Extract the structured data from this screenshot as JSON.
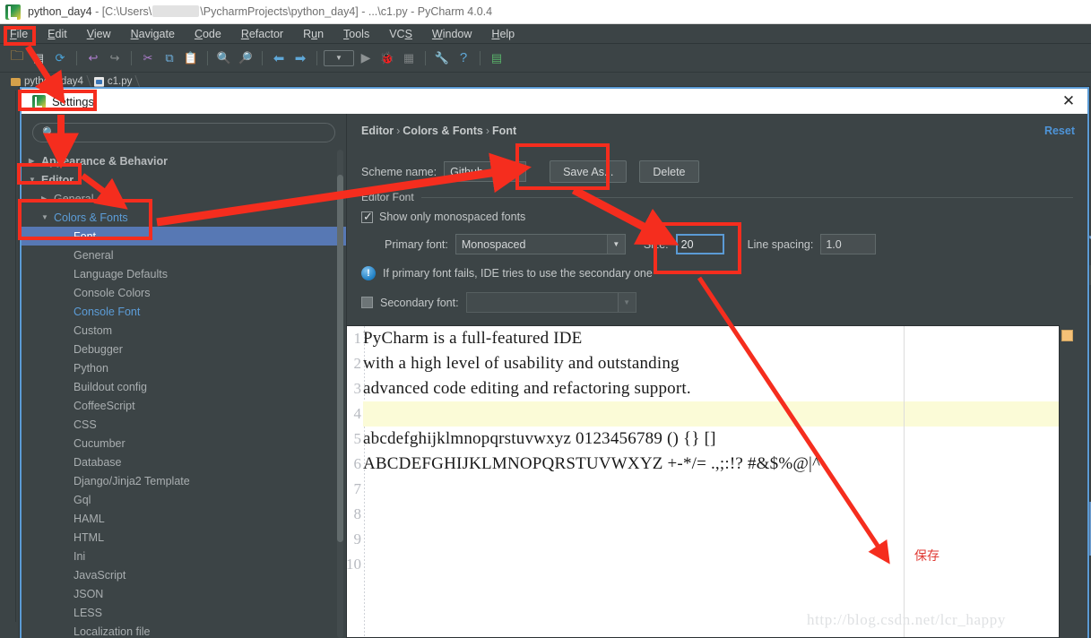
{
  "ide": {
    "window_title_app": "python_day4",
    "window_title_rest_1": " - [C:\\Users\\",
    "window_title_rest_2": "\\PycharmProjects\\python_day4] - ...\\c1.py - PyCharm 4.0.4",
    "logo_icon": "pycharm-logo-icon",
    "menu": [
      {
        "label": "File",
        "mnemonic": "F"
      },
      {
        "label": "Edit",
        "mnemonic": "E"
      },
      {
        "label": "View",
        "mnemonic": "V"
      },
      {
        "label": "Navigate",
        "mnemonic": "N"
      },
      {
        "label": "Code",
        "mnemonic": "C"
      },
      {
        "label": "Refactor",
        "mnemonic": "R"
      },
      {
        "label": "Run",
        "mnemonic": "R"
      },
      {
        "label": "Tools",
        "mnemonic": "T"
      },
      {
        "label": "VCS",
        "mnemonic": "S"
      },
      {
        "label": "Window",
        "mnemonic": "W"
      },
      {
        "label": "Help",
        "mnemonic": "H"
      }
    ],
    "toolbar_icons": [
      "open-folder-icon",
      "save-all-icon",
      "sync-icon",
      "undo-icon",
      "redo-icon",
      "cut-icon",
      "copy-icon",
      "paste-icon",
      "find-icon",
      "find-usages-icon",
      "back-icon",
      "forward-icon",
      "run-configurations-icon",
      "run-icon",
      "debug-icon",
      "coverage-icon",
      "settings-wrench-icon",
      "help-icon",
      "deploy-icon"
    ],
    "tabs": [
      {
        "label": "python_day4",
        "icon": "folder-icon"
      },
      {
        "label": "c1.py",
        "icon": "python-file-icon"
      }
    ]
  },
  "dialog": {
    "title": "Settings",
    "logo_icon": "pycharm-logo-icon",
    "close_icon": "close-icon",
    "search": {
      "placeholder": "",
      "value": "",
      "icon": "search-icon"
    },
    "tree": [
      {
        "label": "Appearance & Behavior",
        "level": 0,
        "twisty": "right",
        "style": "bold"
      },
      {
        "label": "Editor",
        "level": 0,
        "twisty": "down",
        "style": "bold"
      },
      {
        "label": "General",
        "level": 1,
        "twisty": "right",
        "style": "normal"
      },
      {
        "label": "Colors & Fonts",
        "level": 1,
        "twisty": "down",
        "style": "accent"
      },
      {
        "label": "Font",
        "level": 2,
        "twisty": "none",
        "style": "selected"
      },
      {
        "label": "General",
        "level": 2,
        "twisty": "none",
        "style": "normal"
      },
      {
        "label": "Language Defaults",
        "level": 2,
        "twisty": "none",
        "style": "normal"
      },
      {
        "label": "Console Colors",
        "level": 2,
        "twisty": "none",
        "style": "normal"
      },
      {
        "label": "Console Font",
        "level": 2,
        "twisty": "none",
        "style": "accent"
      },
      {
        "label": "Custom",
        "level": 2,
        "twisty": "none",
        "style": "normal"
      },
      {
        "label": "Debugger",
        "level": 2,
        "twisty": "none",
        "style": "normal"
      },
      {
        "label": "Python",
        "level": 2,
        "twisty": "none",
        "style": "normal"
      },
      {
        "label": "Buildout config",
        "level": 2,
        "twisty": "none",
        "style": "normal"
      },
      {
        "label": "CoffeeScript",
        "level": 2,
        "twisty": "none",
        "style": "normal"
      },
      {
        "label": "CSS",
        "level": 2,
        "twisty": "none",
        "style": "normal"
      },
      {
        "label": "Cucumber",
        "level": 2,
        "twisty": "none",
        "style": "normal"
      },
      {
        "label": "Database",
        "level": 2,
        "twisty": "none",
        "style": "normal"
      },
      {
        "label": "Django/Jinja2 Template",
        "level": 2,
        "twisty": "none",
        "style": "normal"
      },
      {
        "label": "Gql",
        "level": 2,
        "twisty": "none",
        "style": "normal"
      },
      {
        "label": "HAML",
        "level": 2,
        "twisty": "none",
        "style": "normal"
      },
      {
        "label": "HTML",
        "level": 2,
        "twisty": "none",
        "style": "normal"
      },
      {
        "label": "Ini",
        "level": 2,
        "twisty": "none",
        "style": "normal"
      },
      {
        "label": "JavaScript",
        "level": 2,
        "twisty": "none",
        "style": "normal"
      },
      {
        "label": "JSON",
        "level": 2,
        "twisty": "none",
        "style": "normal"
      },
      {
        "label": "LESS",
        "level": 2,
        "twisty": "none",
        "style": "normal"
      },
      {
        "label": "Localization file",
        "level": 2,
        "twisty": "none",
        "style": "normal"
      }
    ],
    "breadcrumb": {
      "part1": "Editor",
      "part2": "Colors & Fonts",
      "part3": "Font",
      "separator": "›"
    },
    "reset_label": "Reset",
    "scheme": {
      "label": "Scheme name:",
      "value": "Github con",
      "dropdown_icon": "chevron-down-icon",
      "save_as_label": "Save As...",
      "delete_label": "Delete"
    },
    "editor_font": {
      "group_title": "Editor Font",
      "monospaced_label": "Show only monospaced fonts",
      "monospaced_checked": true,
      "primary_label": "Primary font:",
      "primary_value": "Monospaced",
      "size_label": "Size:",
      "size_value": "20",
      "line_spacing_label": "Line spacing:",
      "line_spacing_value": "1.0",
      "info_icon": "info-icon",
      "info_text": "If primary font fails, IDE tries to use the secondary one",
      "secondary_label": "Secondary font:",
      "secondary_value": "",
      "secondary_checked": false
    },
    "preview": {
      "lines": [
        {
          "num": "1",
          "text": "PyCharm is a full-featured IDE",
          "caret": false
        },
        {
          "num": "2",
          "text": "with a high level of usability and outstanding",
          "caret": false
        },
        {
          "num": "3",
          "text": "advanced code editing and refactoring support.",
          "caret": false
        },
        {
          "num": "4",
          "text": "",
          "caret": true
        },
        {
          "num": "5",
          "text": "abcdefghijklmnopqrstuvwxyz 0123456789 () {} []",
          "caret": false
        },
        {
          "num": "6",
          "text": "ABCDEFGHIJKLMNOPQRSTUVWXYZ +-*/= .,;:!? #&$%@|^",
          "caret": false
        },
        {
          "num": "7",
          "text": "",
          "caret": false
        },
        {
          "num": "8",
          "text": "",
          "caret": false
        },
        {
          "num": "9",
          "text": "",
          "caret": false
        },
        {
          "num": "10",
          "text": "",
          "caret": false
        }
      ],
      "marker_icon": "warning-marker-icon"
    }
  },
  "annotations": {
    "save_note": "保存",
    "watermark": "http://blog.csdn.net/lcr_happy",
    "highlight_color": "#f52d1e",
    "boxes": [
      {
        "name": "file-menu-highlight"
      },
      {
        "name": "settings-title-highlight"
      },
      {
        "name": "editor-node-highlight"
      },
      {
        "name": "colors-fonts-font-highlight"
      },
      {
        "name": "save-as-highlight"
      },
      {
        "name": "size-field-highlight"
      }
    ]
  }
}
